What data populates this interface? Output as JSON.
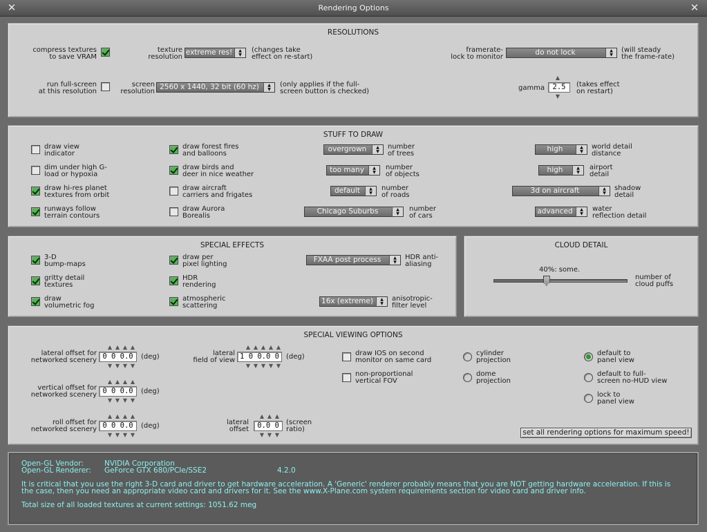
{
  "window": {
    "title": "Rendering Options"
  },
  "resolutions": {
    "title": "RESOLUTIONS",
    "compress_textures": {
      "label": [
        "compress textures",
        "to save VRAM"
      ],
      "checked": true
    },
    "texture_resolution": {
      "label": [
        "texture",
        "resolution"
      ],
      "value": "extreme res!",
      "note": [
        "(changes take",
        "effect on re-start)"
      ]
    },
    "framerate_lock": {
      "label": [
        "framerate-",
        "lock to monitor"
      ],
      "value": "do not lock",
      "note": [
        "(will steady",
        "the frame-rate)"
      ]
    },
    "run_fullscreen": {
      "label": [
        "run full-screen",
        "at this resolution"
      ],
      "checked": false
    },
    "screen_resolution": {
      "label": [
        "screen",
        "resolution"
      ],
      "value": "2560 x 1440, 32 bit (60 hz)",
      "note": [
        "(only applies if the full-",
        "screen button is checked)"
      ]
    },
    "gamma": {
      "label": "gamma",
      "value": "2.5",
      "note": [
        "(takes effect",
        "on restart)"
      ]
    }
  },
  "stuff_to_draw": {
    "title": "STUFF TO DRAW",
    "checkboxes": [
      {
        "label": [
          "draw view",
          "indicator"
        ],
        "checked": false
      },
      {
        "label": [
          "dim under high G-",
          "load or hypoxia"
        ],
        "checked": false
      },
      {
        "label": [
          "draw hi-res planet",
          "textures from orbit"
        ],
        "checked": true
      },
      {
        "label": [
          "runways follow",
          "terrain contours"
        ],
        "checked": true
      },
      {
        "label": [
          "draw forest fires",
          "and balloons"
        ],
        "checked": true
      },
      {
        "label": [
          "draw birds and",
          "deer in nice weather"
        ],
        "checked": true
      },
      {
        "label": [
          "draw aircraft",
          "carriers and frigates"
        ],
        "checked": false
      },
      {
        "label": [
          "draw Aurora",
          "Borealis"
        ],
        "checked": false
      }
    ],
    "dropdowns": [
      {
        "value": "overgrown",
        "label": [
          "number",
          "of trees"
        ]
      },
      {
        "value": "too many",
        "label": [
          "number",
          "of objects"
        ]
      },
      {
        "value": "default",
        "label": [
          "number",
          "of roads"
        ]
      },
      {
        "value": "Chicago Suburbs",
        "label": [
          "number",
          "of cars"
        ]
      },
      {
        "value": "high",
        "label": [
          "world detail",
          "distance"
        ]
      },
      {
        "value": "high",
        "label": [
          "airport",
          "detail"
        ]
      },
      {
        "value": "3d on aircraft",
        "label": [
          "shadow",
          "detail"
        ]
      },
      {
        "value": "advanced",
        "label": [
          "water",
          "reflection detail"
        ]
      }
    ]
  },
  "special_effects": {
    "title": "SPECIAL EFFECTS",
    "checkboxes": [
      {
        "label": [
          "3-D",
          "bump-maps"
        ],
        "checked": true
      },
      {
        "label": [
          "gritty detail",
          "textures"
        ],
        "checked": true
      },
      {
        "label": [
          "draw",
          "volumetric fog"
        ],
        "checked": true
      },
      {
        "label": [
          "draw per",
          "pixel lighting"
        ],
        "checked": true
      },
      {
        "label": [
          "HDR",
          "rendering"
        ],
        "checked": true
      },
      {
        "label": [
          "atmospheric",
          "scattering"
        ],
        "checked": true
      }
    ],
    "dropdowns": [
      {
        "value": "FXAA post process",
        "label": [
          "HDR anti-",
          "aliasing"
        ]
      },
      {
        "value": "16x (extreme)",
        "label": [
          "anisotropic-",
          "filter level"
        ]
      }
    ]
  },
  "cloud_detail": {
    "title": "CLOUD DETAIL",
    "value_label": "40%: some.",
    "fraction": 0.4,
    "label": [
      "number of",
      "cloud puffs"
    ]
  },
  "viewing": {
    "title": "SPECIAL VIEWING OPTIONS",
    "lateral_offset": {
      "label": [
        "lateral offset for",
        "networked scenery"
      ],
      "value": "0 0 0.0",
      "unit": "(deg)"
    },
    "vertical_offset": {
      "label": [
        "vertical offset for",
        "networked scenery"
      ],
      "value": "0 0 0.0",
      "unit": "(deg)"
    },
    "roll_offset": {
      "label": [
        "roll offset for",
        "networked scenery"
      ],
      "value": "0 0 0.0",
      "unit": "(deg)"
    },
    "lateral_fov": {
      "label": [
        "lateral",
        "field of view"
      ],
      "value": "1 0 0.0 0",
      "unit": "(deg)"
    },
    "lateral_screen_offset": {
      "label": [
        "lateral",
        "offset"
      ],
      "value": "0.0 0",
      "unit": [
        "(screen",
        "ratio)"
      ]
    },
    "checkboxes": [
      {
        "label": [
          "draw IOS on second",
          "monitor on same card"
        ],
        "checked": false
      },
      {
        "label": [
          "non-proportional",
          "vertical FOV"
        ],
        "checked": false
      }
    ],
    "projection": [
      {
        "label": [
          "cylinder",
          "projection"
        ],
        "selected": false
      },
      {
        "label": [
          "dome",
          "projection"
        ],
        "selected": false
      }
    ],
    "view_mode": [
      {
        "label": [
          "default to",
          "panel view"
        ],
        "selected": true
      },
      {
        "label": [
          "default to full-",
          "screen no-HUD view"
        ],
        "selected": false
      },
      {
        "label": [
          "lock to",
          "panel view"
        ],
        "selected": false
      }
    ],
    "max_speed_button": "set all rendering options for maximum speed!"
  },
  "info": {
    "vendor_label": "Open-GL Vendor:",
    "vendor_value": "NVIDIA Corporation",
    "renderer_label": "Open-GL Renderer:",
    "renderer_value": "GeForce GTX 680/PCIe/SSE2",
    "version": "4.2.0",
    "warning_1": "It is critical that you use the right 3-D card and driver to get hardware acceleration. A 'Generic' renderer probably means that you are NOT getting hardware acceleration. If this is",
    "warning_2": "the case, then you need an appropriate video card and drivers for it. See the www.X-Plane.com system requirements section for video card and driver info.",
    "texture_total": "Total size of all loaded textures at current settings: 1051.62 meg"
  },
  "colors": {
    "check_on": "#4fb84f",
    "info_text": "#8ef0f0",
    "panel": "#cfcfcf"
  },
  "icons": {
    "close": "close-icon",
    "dropdown": "chevron-updown-icon",
    "stepper": "stepper-arrow-icon"
  }
}
